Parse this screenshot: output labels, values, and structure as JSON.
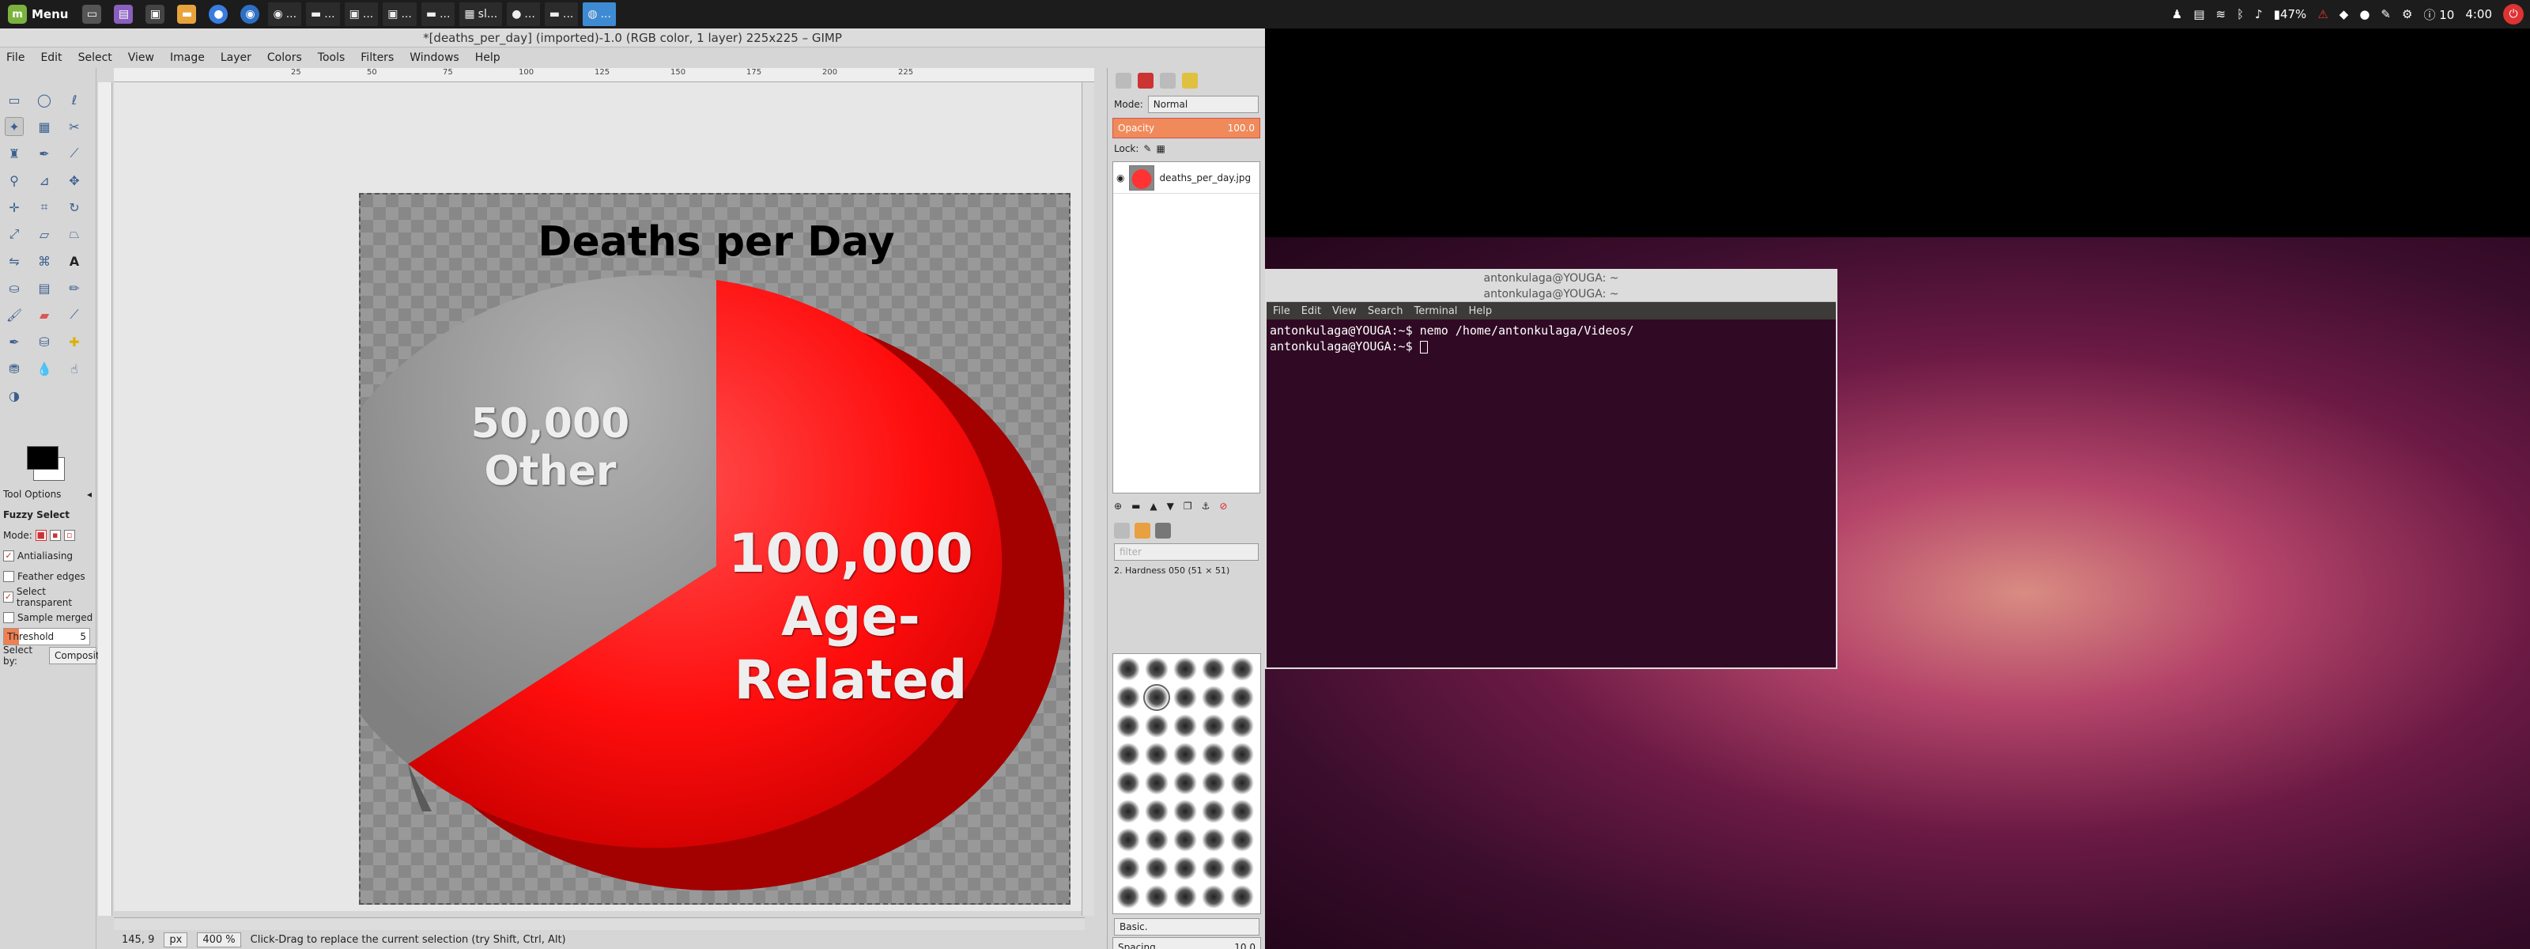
{
  "top_panel": {
    "menu_label": "Menu",
    "tasks": [
      "...",
      "...",
      "...",
      "...",
      "...",
      "sl...",
      "...",
      "...",
      "..."
    ],
    "battery": "47%",
    "notifications": "10",
    "clock": "4:00"
  },
  "gimp": {
    "title": "*[deaths_per_day] (imported)-1.0 (RGB color, 1 layer) 225x225 – GIMP",
    "menu": [
      "File",
      "Edit",
      "Select",
      "View",
      "Image",
      "Layer",
      "Colors",
      "Tools",
      "Filters",
      "Windows",
      "Help"
    ],
    "tool_options": {
      "header": "Tool Options",
      "tool_name": "Fuzzy Select",
      "mode_label": "Mode:",
      "antialiasing": "Antialiasing",
      "feather_edges": "Feather edges",
      "select_transparent": "Select transparent",
      "sample_merged": "Sample merged",
      "threshold_label": "Threshold",
      "threshold_value": "5",
      "select_by_label": "Select by:",
      "select_by_value": "Composite"
    },
    "ruler_marks": [
      "25",
      "50",
      "75",
      "100",
      "125",
      "150",
      "175",
      "200",
      "225"
    ],
    "status": {
      "coords": "145, 9",
      "unit": "px",
      "zoom": "400 %",
      "hint": "Click-Drag to replace the current selection (try Shift, Ctrl, Alt)"
    },
    "image": {
      "title": "Deaths per Day",
      "slices": [
        {
          "value_label": "50,000",
          "name": "Other",
          "value": 50000,
          "color": "#999999"
        },
        {
          "value_label": "100,000",
          "name": "Age-Related",
          "value": 100000,
          "color": "#ff1a1a"
        }
      ]
    },
    "layers": {
      "mode_label": "Mode:",
      "mode_value": "Normal",
      "opacity_label": "Opacity",
      "opacity_value": "100.0",
      "lock_label": "Lock:",
      "layer_name": "deaths_per_day.jpg"
    },
    "brushes": {
      "filter_placeholder": "filter",
      "selected_brush": "2. Hardness 050 (51 × 51)",
      "preset": "Basic.",
      "spacing_label": "Spacing",
      "spacing_value": "10.0"
    }
  },
  "terminal": {
    "title": "antonkulaga@YOUGA: ~",
    "menu": [
      "File",
      "Edit",
      "View",
      "Search",
      "Terminal",
      "Help"
    ],
    "lines": [
      "antonkulaga@YOUGA:~$ nemo /home/antonkulaga/Videos/",
      "antonkulaga@YOUGA:~$ "
    ]
  }
}
